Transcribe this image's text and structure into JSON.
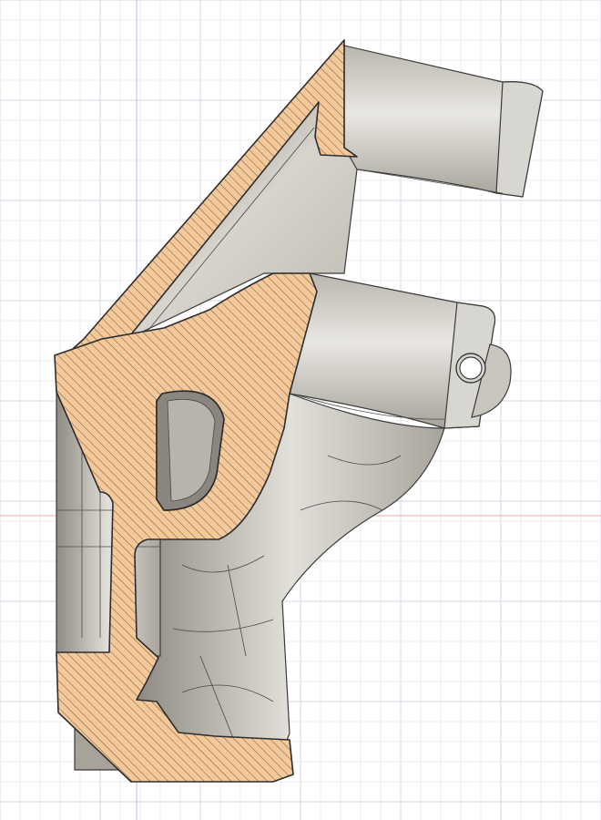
{
  "viewport": {
    "background": "#ffffff",
    "grid_minor_color": "#ececf2",
    "grid_major_color": "#d6d6e2",
    "axis_vertical_color": "#b9b9e4",
    "axis_horizontal_color": "#f0a8a8"
  },
  "model": {
    "section_fill": "#f3c99c",
    "section_hatch": "#6b4a2a",
    "body_color": "#cfccc4",
    "body_shadow": "#9a968d",
    "edge_color": "#3a3a3a",
    "feature_icon": "mount-hole-icon"
  }
}
